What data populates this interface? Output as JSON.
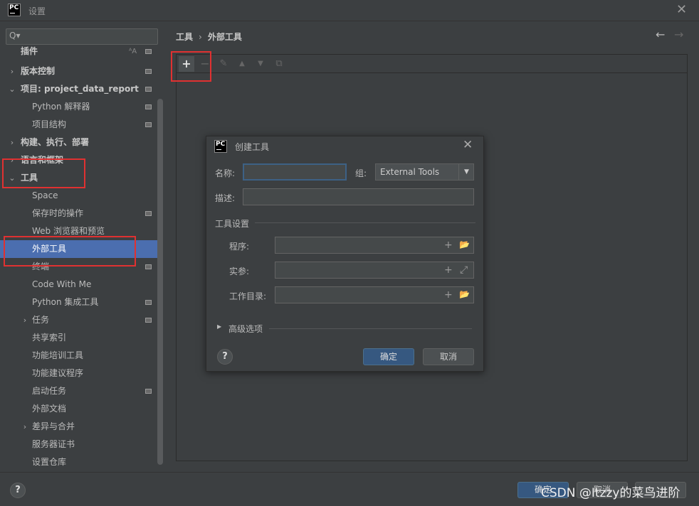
{
  "window": {
    "logo_text": "PC",
    "title": "设置",
    "close_glyph": "✕"
  },
  "sidebar": {
    "search_placeholder": "",
    "search_icon": "Q▾",
    "items": [
      {
        "label": "插件",
        "arrow": ""
      },
      {
        "label": "版本控制",
        "arrow": "›"
      },
      {
        "label": "项目: project_data_report",
        "arrow": "⌄"
      },
      {
        "label": "Python 解释器",
        "arrow": ""
      },
      {
        "label": "项目结构",
        "arrow": ""
      },
      {
        "label": "构建、执行、部署",
        "arrow": "›"
      },
      {
        "label": "语言和框架",
        "arrow": "›"
      },
      {
        "label": "工具",
        "arrow": "⌄"
      },
      {
        "label": "Space",
        "arrow": ""
      },
      {
        "label": "保存时的操作",
        "arrow": ""
      },
      {
        "label": "Web 浏览器和预览",
        "arrow": ""
      },
      {
        "label": "外部工具",
        "arrow": ""
      },
      {
        "label": "终端",
        "arrow": ""
      },
      {
        "label": "Code With Me",
        "arrow": ""
      },
      {
        "label": "Python 集成工具",
        "arrow": ""
      },
      {
        "label": "任务",
        "arrow": "›"
      },
      {
        "label": "共享索引",
        "arrow": ""
      },
      {
        "label": "功能培训工具",
        "arrow": ""
      },
      {
        "label": "功能建议程序",
        "arrow": ""
      },
      {
        "label": "启动任务",
        "arrow": ""
      },
      {
        "label": "外部文档",
        "arrow": ""
      },
      {
        "label": "差异与合并",
        "arrow": "›"
      },
      {
        "label": "服务器证书",
        "arrow": ""
      },
      {
        "label": "设置仓库",
        "arrow": ""
      }
    ],
    "plugin_badge": "ᴬA"
  },
  "breadcrumb": {
    "parent": "工具",
    "separator": "›",
    "current": "外部工具"
  },
  "nav": {
    "back": "←",
    "forward": "→"
  },
  "toolbar": {
    "add": "+",
    "remove": "−",
    "edit": "✎",
    "up": "▲",
    "down": "▼",
    "copy": "⧉"
  },
  "dialog": {
    "logo_text": "PC",
    "title": "创建工具",
    "close_glyph": "✕",
    "name_label": "名称:",
    "name_value": "",
    "group_label": "组:",
    "group_value": "External Tools",
    "group_dropdown": "▼",
    "desc_label": "描述:",
    "desc_value": "",
    "tool_settings": "工具设置",
    "program_label": "程序:",
    "args_label": "实参:",
    "workdir_label": "工作目录:",
    "plus": "+",
    "folder": "📂",
    "expand": "⤢",
    "advanced": "高级选项",
    "advanced_arrow": "▶",
    "help": "?",
    "ok": "确定",
    "cancel": "取消"
  },
  "footer": {
    "help": "?",
    "ok": "确定",
    "cancel": "取消",
    "apply": "",
    "watermark": "CSDN @Itzzy的菜鸟进阶"
  },
  "colors": {
    "selection": "#4b6eaf",
    "highlight": "#e03131",
    "primary_button": "#365880"
  }
}
